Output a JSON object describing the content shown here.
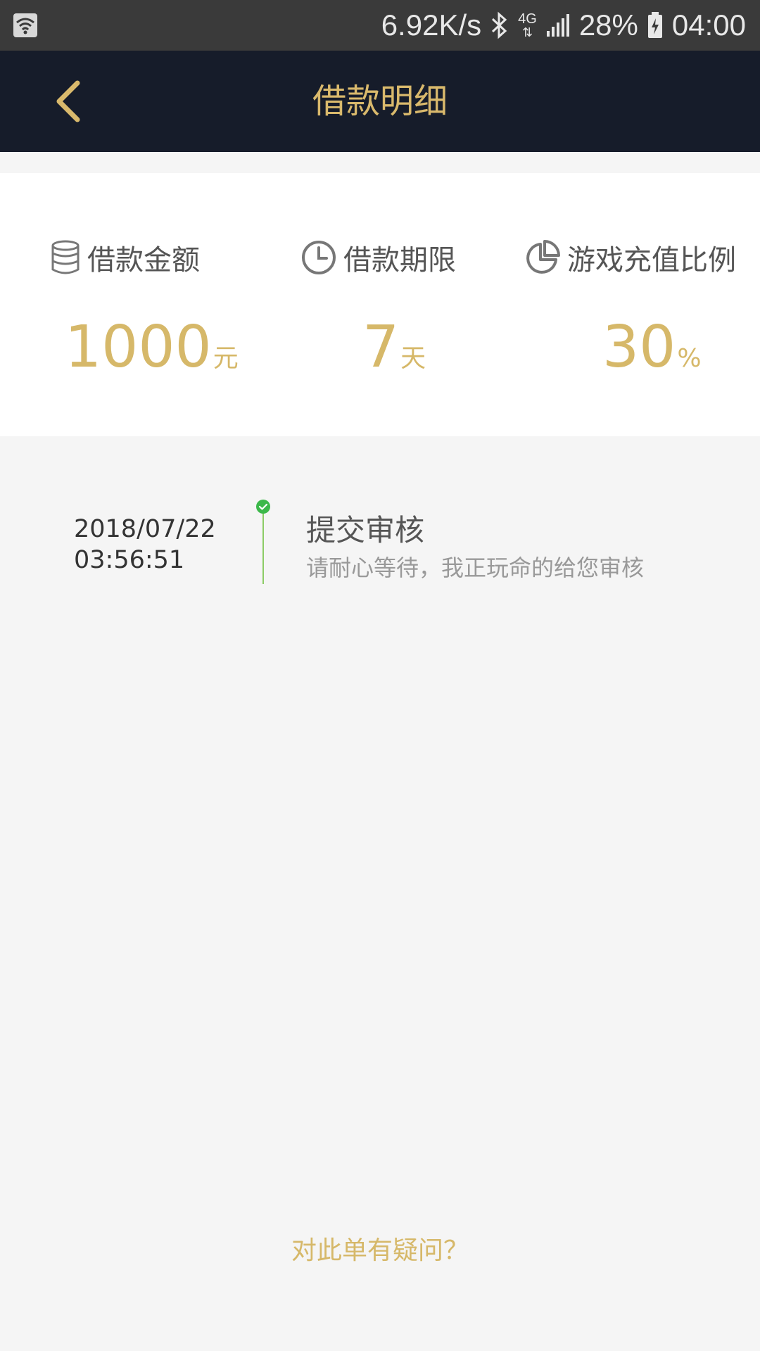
{
  "status_bar": {
    "network_speed": "6.92K/s",
    "network_type": "4G",
    "battery": "28%",
    "time": "04:00",
    "icons": [
      "wifi-icon",
      "bluetooth-icon",
      "signal-icon",
      "battery-icon"
    ]
  },
  "header": {
    "title": "借款明细",
    "back_icon": "chevron-left-icon"
  },
  "summary": {
    "amount": {
      "label": "借款金额",
      "value": "1000",
      "unit": "元",
      "icon": "coin-stack-icon"
    },
    "term": {
      "label": "借款期限",
      "value": "7",
      "unit": "天",
      "icon": "clock-icon"
    },
    "ratio": {
      "label": "游戏充值比例",
      "value": "30",
      "unit": "%",
      "icon": "pie-chart-icon"
    }
  },
  "timeline": [
    {
      "date": "2018/07/22",
      "time": "03:56:51",
      "title": "提交审核",
      "description": "请耐心等待，我正玩命的给您审核",
      "status_icon": "check-circle-icon"
    }
  ],
  "footer": {
    "question_link": "对此单有疑问？"
  },
  "colors": {
    "header_bg": "#161c2a",
    "accent_gold": "#d6b869",
    "status_green": "#3cb84a"
  }
}
